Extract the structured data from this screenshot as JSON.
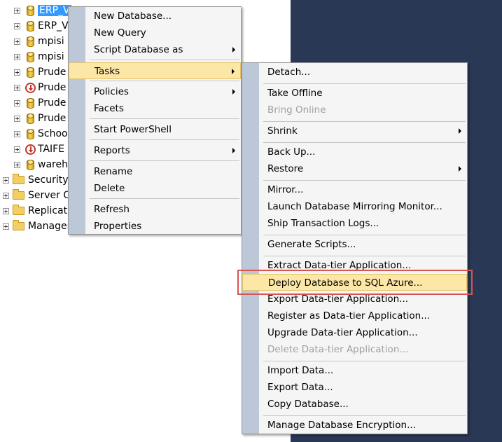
{
  "tree": {
    "databases": [
      {
        "label": "ERP_V",
        "icon": "database-icon",
        "selected": true
      },
      {
        "label": "ERP_V",
        "icon": "database-icon"
      },
      {
        "label": "mpisi",
        "icon": "database-icon"
      },
      {
        "label": "mpisi",
        "icon": "database-icon"
      },
      {
        "label": "Prude",
        "icon": "database-icon"
      },
      {
        "label": "Prude",
        "icon": "database-offline-icon"
      },
      {
        "label": "Prude",
        "icon": "database-icon"
      },
      {
        "label": "Prude",
        "icon": "database-icon"
      },
      {
        "label": "Schoo",
        "icon": "database-icon"
      },
      {
        "label": "TAIFE",
        "icon": "database-offline-icon"
      },
      {
        "label": "wareh",
        "icon": "database-icon"
      }
    ],
    "folders": [
      {
        "label": "Security"
      },
      {
        "label": "Server Ol"
      },
      {
        "label": "Replicati"
      },
      {
        "label": "Manager"
      }
    ]
  },
  "context_menu": {
    "items": [
      {
        "label": "New Database..."
      },
      {
        "label": "New Query"
      },
      {
        "label": "Script Database as",
        "submenu": true
      },
      {
        "label": "Tasks",
        "submenu": true,
        "state": "hover"
      },
      {
        "label": "Policies",
        "submenu": true
      },
      {
        "label": "Facets"
      },
      {
        "label": "Start PowerShell"
      },
      {
        "label": "Reports",
        "submenu": true
      },
      {
        "label": "Rename"
      },
      {
        "label": "Delete"
      },
      {
        "label": "Refresh"
      },
      {
        "label": "Properties"
      }
    ]
  },
  "tasks_menu": {
    "items": [
      {
        "label": "Detach..."
      },
      {
        "label": "Take Offline"
      },
      {
        "label": "Bring Online",
        "disabled": true
      },
      {
        "label": "Shrink",
        "submenu": true
      },
      {
        "label": "Back Up..."
      },
      {
        "label": "Restore",
        "submenu": true
      },
      {
        "label": "Mirror..."
      },
      {
        "label": "Launch Database Mirroring Monitor..."
      },
      {
        "label": "Ship Transaction Logs..."
      },
      {
        "label": "Generate Scripts..."
      },
      {
        "label": "Extract Data-tier Application..."
      },
      {
        "label": "Deploy Database to SQL Azure...",
        "state": "hover"
      },
      {
        "label": "Export Data-tier Application..."
      },
      {
        "label": "Register as Data-tier Application..."
      },
      {
        "label": "Upgrade Data-tier Application..."
      },
      {
        "label": "Delete Data-tier Application...",
        "disabled": true
      },
      {
        "label": "Import Data..."
      },
      {
        "label": "Export Data..."
      },
      {
        "label": "Copy Database..."
      },
      {
        "label": "Manage Database Encryption..."
      }
    ]
  },
  "colors": {
    "background_pane": "#293955",
    "menu_gutter": "#bcc7d8",
    "hover_fill": "#fde7a6",
    "annotation_box": "#d9534f",
    "selection": "#3399ff"
  }
}
